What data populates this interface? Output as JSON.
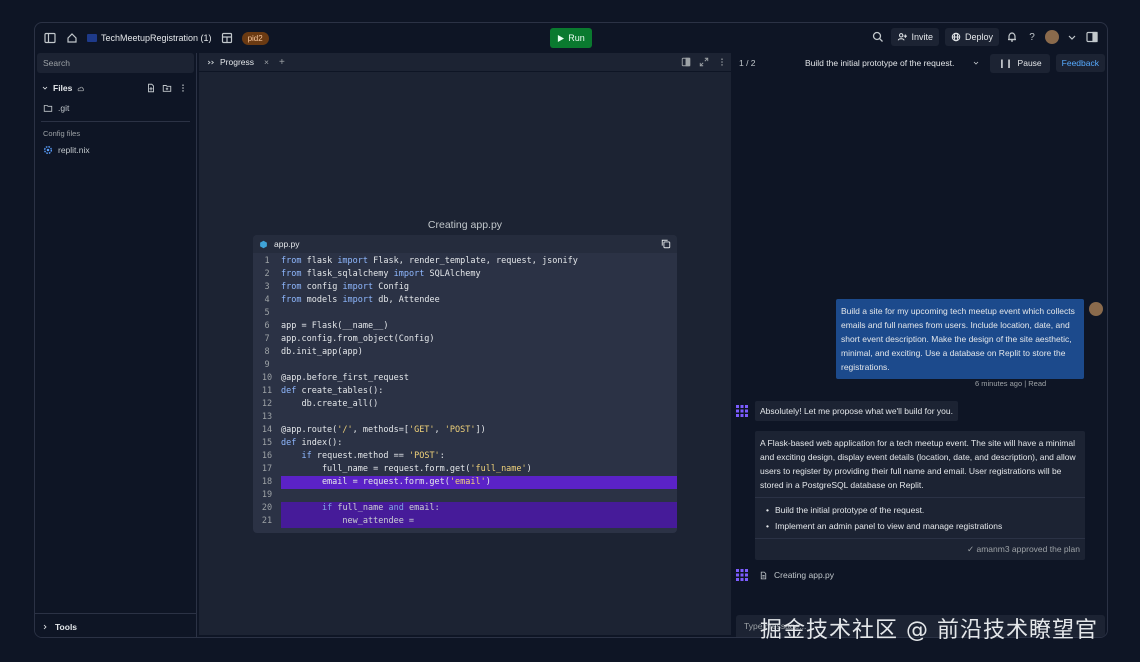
{
  "topbar": {
    "repl_name": "TechMeetupRegistration (1)",
    "pid_badge": "pid2",
    "run_label": "Run",
    "invite_label": "Invite",
    "deploy_label": "Deploy"
  },
  "files_pane": {
    "search_placeholder": "Search",
    "files_title": "Files",
    "items": [
      ".git"
    ],
    "config_label": "Config files",
    "config_items": [
      "replit.nix"
    ],
    "tools_label": "Tools"
  },
  "progress_pane": {
    "tab_label": "Progress",
    "title": "Creating app.py",
    "code_filename": "app.py",
    "code_lines": [
      {
        "n": "1",
        "text": "from flask import Flask, render_template, request, jsonify"
      },
      {
        "n": "2",
        "text": "from flask_sqlalchemy import SQLAlchemy"
      },
      {
        "n": "3",
        "text": "from config import Config"
      },
      {
        "n": "4",
        "text": "from models import db, Attendee"
      },
      {
        "n": "5",
        "text": ""
      },
      {
        "n": "6",
        "text": "app = Flask(__name__)"
      },
      {
        "n": "7",
        "text": "app.config.from_object(Config)"
      },
      {
        "n": "8",
        "text": "db.init_app(app)"
      },
      {
        "n": "9",
        "text": ""
      },
      {
        "n": "10",
        "text": "@app.before_first_request"
      },
      {
        "n": "11",
        "text": "def create_tables():"
      },
      {
        "n": "12",
        "text": "    db.create_all()"
      },
      {
        "n": "13",
        "text": ""
      },
      {
        "n": "14",
        "text": "@app.route('/', methods=['GET', 'POST'])"
      },
      {
        "n": "15",
        "text": "def index():"
      },
      {
        "n": "16",
        "text": "    if request.method == 'POST':"
      },
      {
        "n": "17",
        "text": "        full_name = request.form.get('full_name')"
      },
      {
        "n": "18",
        "text": "        email = request.form.get('email')"
      },
      {
        "n": "19",
        "text": ""
      },
      {
        "n": "20",
        "text": "        if full_name and email:"
      },
      {
        "n": "21",
        "text": "            new_attendee = "
      }
    ]
  },
  "chat_pane": {
    "step_count": "1 / 2",
    "step_title": "Build the initial prototype of the request.",
    "pause_label": "Pause",
    "feedback_label": "Feedback",
    "user_message": "Build a site for my upcoming tech meetup event which collects emails and full names from users. Include location, date, and short event description. Make the design of the site aesthetic, minimal, and exciting. Use a database on Replit to store the registrations.",
    "user_meta": "6 minutes ago | Read",
    "agent_message": "Absolutely! Let me propose what we'll build for you.",
    "plan_text": "A Flask-based web application for a tech meetup event. The site will have a minimal and exciting design, display event details (location, date, and description), and allow users to register by providing their full name and email. User registrations will be stored in a PostgreSQL database on Replit.",
    "plan_steps": [
      "Build the initial prototype of the request.",
      "Implement an admin panel to view and manage registrations"
    ],
    "plan_approved": "amanm3 approved the plan",
    "creating_label": "Creating app.py",
    "input_placeholder": "Type message..."
  },
  "watermark": "掘金技术社区 @ 前沿技术瞭望官"
}
